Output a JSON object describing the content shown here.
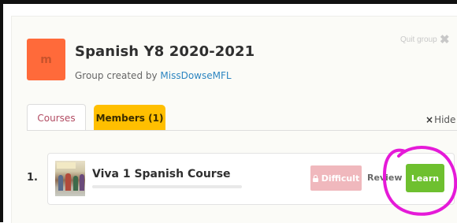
{
  "group": {
    "avatar_letter": "m",
    "title": "Spanish Y8 2020-2021",
    "created_prefix": "Group created by ",
    "creator": "MissDowseMFL",
    "quit_label": "Quit group",
    "quit_icon": "close-icon"
  },
  "tabs": {
    "courses": "Courses",
    "members": "Members (1)",
    "hide_icon": "×",
    "hide_label": "Hide"
  },
  "courses": [
    {
      "number": "1.",
      "name": "Viva 1 Spanish Course",
      "progress_percent": 0,
      "difficult_label": "Difficult",
      "review_label": "Review",
      "learn_label": "Learn"
    }
  ],
  "colors": {
    "avatar": "#ff6a3a",
    "members_tab": "#ffbf00",
    "learn_button": "#6ec02f",
    "difficult_button": "#f0b8bd",
    "annotation": "#e51ad8"
  }
}
